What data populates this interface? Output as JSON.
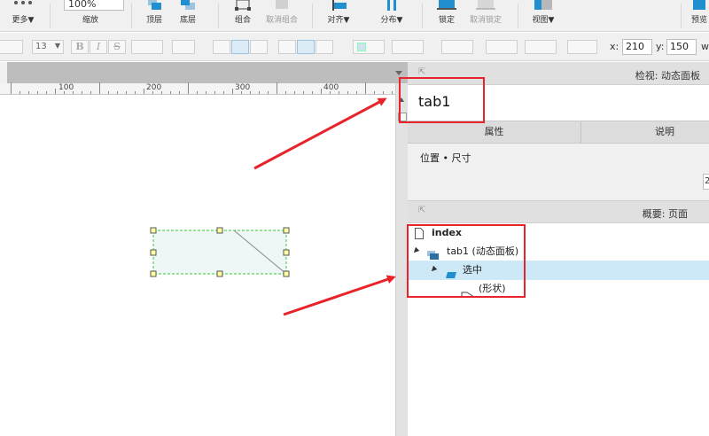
{
  "toolbar": {
    "more_label": "更多▼",
    "zoom_value": "100%",
    "zoom_label": "缩放",
    "front_label": "顶层",
    "back_label": "底层",
    "group_label": "组合",
    "ungroup_label": "取消组合",
    "align_label": "对齐▼",
    "distribute_label": "分布▼",
    "lock_label": "锁定",
    "unlock_label": "取消锁定",
    "view_label": "视图▼",
    "preview_label": "预览"
  },
  "formatbar": {
    "font_size": "13",
    "bold": "B",
    "italic": "I",
    "underline": "S",
    "x_label": "x:",
    "x_value": "210",
    "y_label": "y:",
    "y_value": "150",
    "w_label": "w"
  },
  "ruler": {
    "labels": [
      "100",
      "200",
      "300",
      "400"
    ]
  },
  "inspector": {
    "title": "检视: 动态面板",
    "name_value": "tab1",
    "tabs": [
      "属性",
      "说明"
    ],
    "section": "位置 • 尺寸",
    "stub_value": "2"
  },
  "outline": {
    "title": "概要: 页面",
    "items": [
      {
        "label": "index"
      },
      {
        "label": "tab1 (动态面板)"
      },
      {
        "label": "选中"
      },
      {
        "label": "(形状)"
      }
    ]
  },
  "colors": {
    "annotation_red": "#e8232a",
    "selection_blue": "#cde8f6",
    "shape_fill": "#eef6f6",
    "shape_border": "#33cc33"
  }
}
